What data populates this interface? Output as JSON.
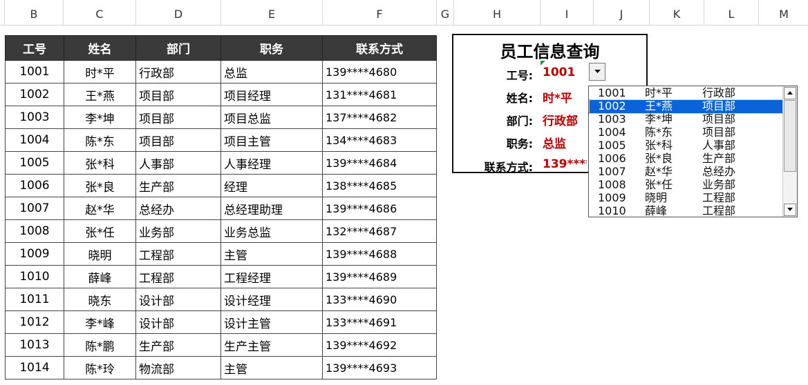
{
  "columns": [
    "B",
    "C",
    "D",
    "E",
    "F",
    "G",
    "H",
    "I",
    "J",
    "K",
    "L",
    "M"
  ],
  "table": {
    "headers": [
      "工号",
      "姓名",
      "部门",
      "职务",
      "联系方式"
    ],
    "rows": [
      [
        "1001",
        "时*平",
        "行政部",
        "总监",
        "139****4680"
      ],
      [
        "1002",
        "王*燕",
        "项目部",
        "项目经理",
        "131****4681"
      ],
      [
        "1003",
        "李*坤",
        "项目部",
        "项目总监",
        "137****4682"
      ],
      [
        "1004",
        "陈*东",
        "项目部",
        "项目主管",
        "134****4683"
      ],
      [
        "1005",
        "张*科",
        "人事部",
        "人事经理",
        "139****4684"
      ],
      [
        "1006",
        "张*良",
        "生产部",
        "经理",
        "138****4685"
      ],
      [
        "1007",
        "赵*华",
        "总经办",
        "总经理助理",
        "139****4686"
      ],
      [
        "1008",
        "张*任",
        "业务部",
        "业务总监",
        "132****4687"
      ],
      [
        "1009",
        "晓明",
        "工程部",
        "主管",
        "139****4688"
      ],
      [
        "1010",
        "薛峰",
        "工程部",
        "工程经理",
        "139****4689"
      ],
      [
        "1011",
        "晓东",
        "设计部",
        "设计经理",
        "133****4690"
      ],
      [
        "1012",
        "李*峰",
        "设计部",
        "设计主管",
        "133****4691"
      ],
      [
        "1013",
        "陈*鹏",
        "生产部",
        "生产主管",
        "139****4692"
      ],
      [
        "1014",
        "陈*玲",
        "物流部",
        "主管",
        "139****4693"
      ]
    ]
  },
  "query": {
    "title": "员工信息查询",
    "labels": {
      "id": "工号:",
      "name": "姓名:",
      "dept": "部门:",
      "position": "职务:",
      "contact": "联系方式:"
    },
    "values": {
      "id": "1001",
      "name": "时*平",
      "dept": "行政部",
      "position": "总监",
      "contact": "139****4680"
    }
  },
  "dropdown": {
    "selected_index": 1,
    "items": [
      [
        "1001",
        "时*平",
        "行政部"
      ],
      [
        "1002",
        "王*燕",
        "项目部"
      ],
      [
        "1003",
        "李*坤",
        "项目部"
      ],
      [
        "1004",
        "陈*东",
        "项目部"
      ],
      [
        "1005",
        "张*科",
        "人事部"
      ],
      [
        "1006",
        "张*良",
        "生产部"
      ],
      [
        "1007",
        "赵*华",
        "总经办"
      ],
      [
        "1008",
        "张*任",
        "业务部"
      ],
      [
        "1009",
        "晓明",
        "工程部"
      ],
      [
        "1010",
        "薛峰",
        "工程部"
      ]
    ]
  },
  "icons": {
    "dropdown_arrow": "chevron-down-icon",
    "scroll_up": "scroll-up-icon",
    "scroll_down": "scroll-down-icon"
  },
  "colors": {
    "header_bg": "#3a3a3a",
    "value_red": "#c00000",
    "selection_blue": "#0a64d8"
  }
}
